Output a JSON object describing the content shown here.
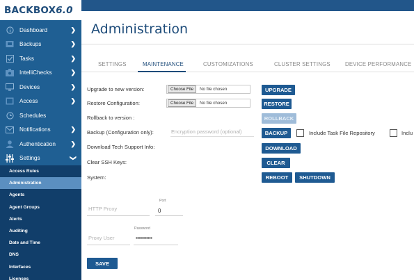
{
  "brand": {
    "name": "BACKBOX",
    "version": "6.0"
  },
  "topbar": {
    "text": ""
  },
  "sidebar": {
    "items": [
      {
        "label": "Dashboard",
        "icon": "info-icon",
        "chevron": true
      },
      {
        "label": "Backups",
        "icon": "backup-icon",
        "chevron": true
      },
      {
        "label": "Tasks",
        "icon": "tasks-icon",
        "chevron": true
      },
      {
        "label": "IntelliChecks",
        "icon": "intellichecks-icon",
        "chevron": true
      },
      {
        "label": "Devices",
        "icon": "devices-icon",
        "chevron": true
      },
      {
        "label": "Access",
        "icon": "access-icon",
        "chevron": true
      },
      {
        "label": "Schedules",
        "icon": "clock-icon",
        "chevron": false
      },
      {
        "label": "Notifications",
        "icon": "mail-icon",
        "chevron": true
      },
      {
        "label": "Authentication",
        "icon": "user-icon",
        "chevron": true
      },
      {
        "label": "Settings",
        "icon": "sliders-icon",
        "chevron": true
      }
    ],
    "settings_sub": [
      "Access Rules",
      "Administration",
      "Agents",
      "Agent Groups",
      "Alerts",
      "Auditing",
      "Date and Time",
      "DNS",
      "Interfaces",
      "Licenses"
    ],
    "active_sub": "Administration"
  },
  "main": {
    "title": "Administration",
    "tabs": [
      "SETTINGS",
      "MAINTENANCE",
      "CUSTOMIZATIONS",
      "CLUSTER SETTINGS",
      "DEVICE PERFORMANCE"
    ],
    "active_tab": "MAINTENANCE",
    "rows": {
      "upgrade_label": "Upgrade to new version:",
      "restore_label": "Restore Configuration:",
      "rollback_label": "Rollback to version :",
      "backup_label": "Backup (Configuration only):",
      "download_label": "Download Tech Support Info:",
      "clear_label": "Clear SSH Keys:",
      "system_label": "System:"
    },
    "file": {
      "button": "Choose File",
      "status": "No file chosen"
    },
    "buttons": {
      "upgrade": "UPGRADE",
      "restore": "RESTORE",
      "rollback": "ROLLBACK",
      "backup": "BACKUP",
      "download": "DOWNLOAD",
      "clear": "CLEAR",
      "reboot": "REBOOT",
      "shutdown": "SHUTDOWN",
      "save": "SAVE"
    },
    "backup_password_placeholder": "Encryption password (optional)",
    "include_task_repo": "Include Task File Repository",
    "include_truncated": "Inclu",
    "proxy": {
      "http_label": "HTTP Proxy",
      "port_label": "Port",
      "port_value": "0",
      "user_label": "Proxy User",
      "password_label": "Password",
      "password_value": "••••••••••••"
    }
  }
}
